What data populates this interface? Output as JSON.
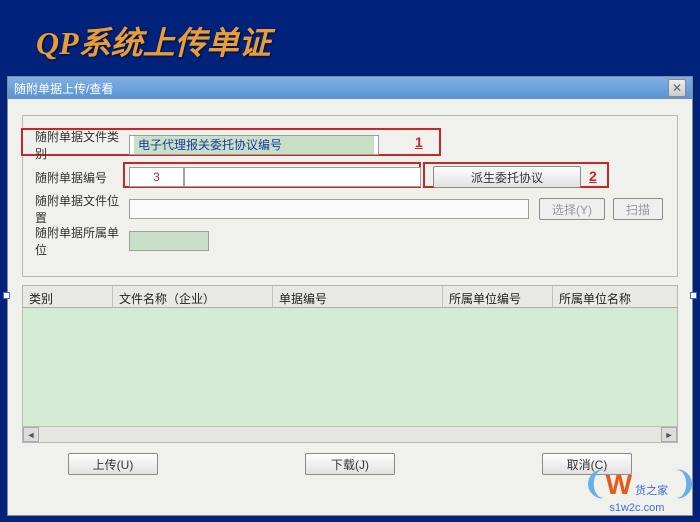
{
  "page_title": "QP系统上传单证",
  "window": {
    "title": "随附单据上传/查看"
  },
  "form": {
    "row1": {
      "label": "随附单据文件类别",
      "value": "电子代理报关委托协议编号"
    },
    "row2": {
      "label": "随附单据编号",
      "code": "3",
      "derive_btn": "派生委托协议"
    },
    "row3": {
      "label": "随附单据文件位置",
      "value": "",
      "select_btn": "选择(Y)",
      "scan_btn": "扫描"
    },
    "row4": {
      "label": "随附单据所属单位",
      "value": ""
    }
  },
  "callouts": {
    "c1": "1",
    "c2": "2",
    "c3": "3"
  },
  "table": {
    "cols": [
      "类别",
      "文件名称（企业）",
      "单据编号",
      "所属单位编号",
      "所属单位名称"
    ]
  },
  "buttons": {
    "upload": "上传(U)",
    "download": "下载(J)",
    "cancel": "取消(C)"
  },
  "watermark": {
    "brand": "货之家",
    "url": "s1w2c.com"
  }
}
